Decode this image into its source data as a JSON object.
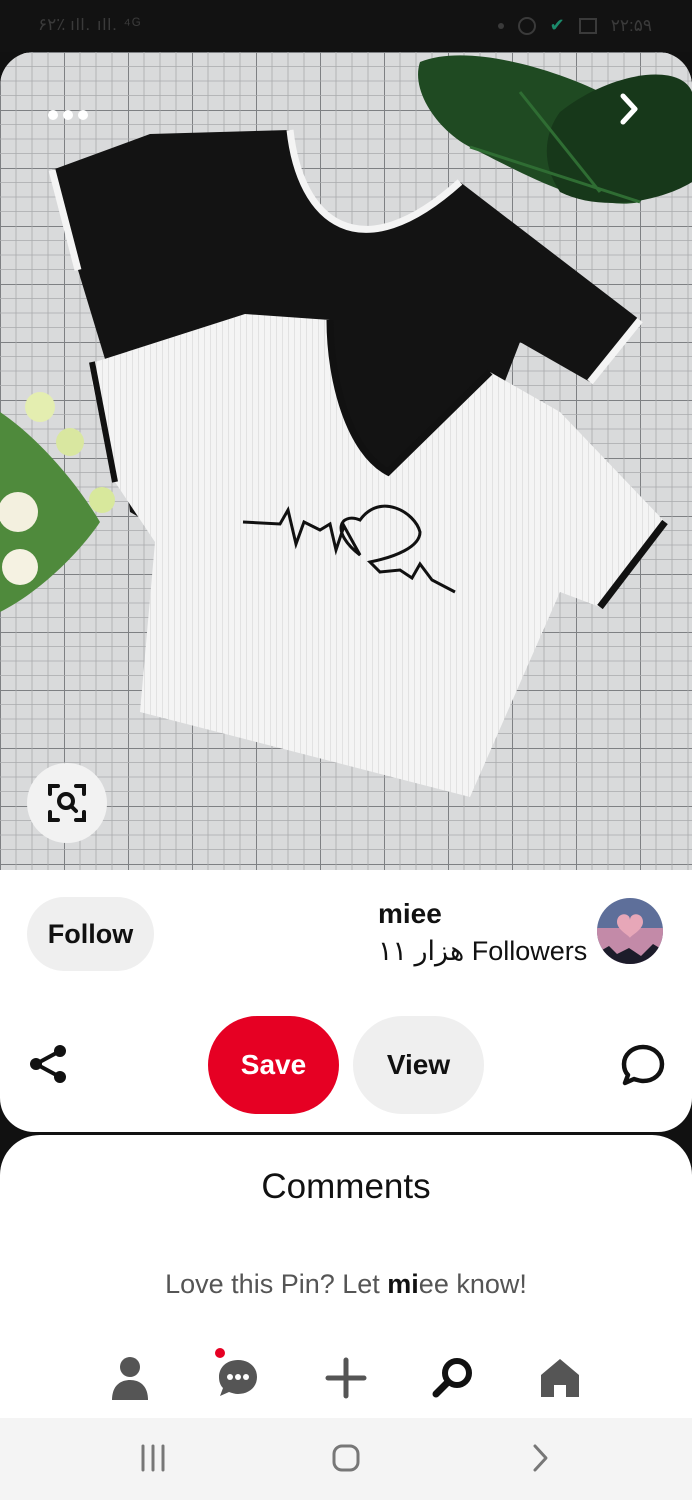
{
  "status_bar": {
    "left_text": "۶۲٪ ıll. ıll. ⁴ᴳ",
    "time": "۲۲:۵۹"
  },
  "pin": {
    "image_alt": "Black and white V-neck crop t-shirts with heartbeat print",
    "more_icon": "more-horizontal-icon",
    "next_icon": "chevron-right-icon",
    "lens_icon": "visual-search-icon"
  },
  "creator": {
    "follow_label": "Follow",
    "name": "miee",
    "followers": "۱۱ هزار Followers"
  },
  "actions": {
    "share_icon": "share-icon",
    "save_label": "Save",
    "view_label": "View",
    "comment_icon": "comment-bubble-icon"
  },
  "comments": {
    "title": "Comments",
    "prompt_prefix": "Love this Pin? Let ",
    "prompt_bold": "mi",
    "prompt_suffix": "ee know!"
  },
  "tabs": [
    {
      "icon": "profile-icon"
    },
    {
      "icon": "messages-icon"
    },
    {
      "icon": "create-plus-icon"
    },
    {
      "icon": "search-icon"
    },
    {
      "icon": "home-icon"
    }
  ],
  "system_nav": {
    "recents_icon": "recents-icon",
    "home_icon": "home-circle-icon",
    "back_icon": "back-chevron-icon"
  },
  "colors": {
    "brand_red": "#e60023",
    "button_gray": "#efefef"
  }
}
